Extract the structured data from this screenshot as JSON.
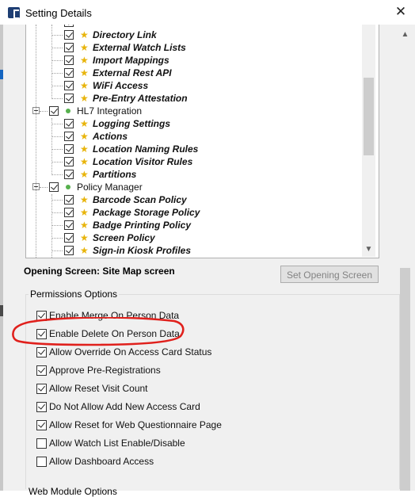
{
  "window": {
    "title": "Setting Details"
  },
  "tree": {
    "items": [
      {
        "label": "Directory Link",
        "level": "leaf",
        "checked": true
      },
      {
        "label": "External Watch Lists",
        "level": "leaf",
        "checked": true
      },
      {
        "label": "Import Mappings",
        "level": "leaf",
        "checked": true
      },
      {
        "label": "External Rest API",
        "level": "leaf",
        "checked": true
      },
      {
        "label": "WiFi Access",
        "level": "leaf",
        "checked": true
      },
      {
        "label": "Pre-Entry Attestation",
        "level": "leaf",
        "checked": true
      },
      {
        "label": "HL7 Integration",
        "level": "group",
        "checked": true,
        "expanded": true
      },
      {
        "label": "Logging Settings",
        "level": "leaf",
        "checked": true
      },
      {
        "label": "Actions",
        "level": "leaf",
        "checked": true
      },
      {
        "label": "Location Naming Rules",
        "level": "leaf",
        "checked": true
      },
      {
        "label": "Location Visitor Rules",
        "level": "leaf",
        "checked": true
      },
      {
        "label": "Partitions",
        "level": "leaf",
        "checked": true
      },
      {
        "label": "Policy Manager",
        "level": "group",
        "checked": true,
        "expanded": true
      },
      {
        "label": "Barcode Scan Policy",
        "level": "leaf",
        "checked": true
      },
      {
        "label": "Package Storage Policy",
        "level": "leaf",
        "checked": true
      },
      {
        "label": "Badge Printing Policy",
        "level": "leaf",
        "checked": true
      },
      {
        "label": "Screen Policy",
        "level": "leaf",
        "checked": true
      },
      {
        "label": "Sign-in Kiosk Profiles",
        "level": "leaf",
        "checked": true
      }
    ]
  },
  "opening_screen": {
    "label": "Opening Screen:  Site Map screen",
    "button_label": "Set Opening Screen"
  },
  "permissions": {
    "title": "Permissions Options",
    "options": [
      {
        "label": "Enable Merge On Person Data",
        "checked": true
      },
      {
        "label": "Enable Delete On Person Data",
        "checked": true
      },
      {
        "label": "Allow Override On Access Card Status",
        "checked": true
      },
      {
        "label": "Approve Pre-Registrations",
        "checked": true
      },
      {
        "label": "Allow Reset Visit Count",
        "checked": true
      },
      {
        "label": "Do Not Allow Add New Access Card",
        "checked": true
      },
      {
        "label": "Allow Reset for Web Questionnaire Page",
        "checked": true
      },
      {
        "label": "Allow Watch List Enable/Disable",
        "checked": false
      },
      {
        "label": "Allow Dashboard Access",
        "checked": false
      }
    ]
  },
  "web_module": {
    "title": "Web Module Options"
  },
  "colors": {
    "accent_star": "#e8b40a",
    "annotation": "#e0201c",
    "status_dot": "#56b04d"
  },
  "icons": {
    "close": "close-icon",
    "star": "star-icon",
    "expand": "collapse-toggle-icon"
  }
}
